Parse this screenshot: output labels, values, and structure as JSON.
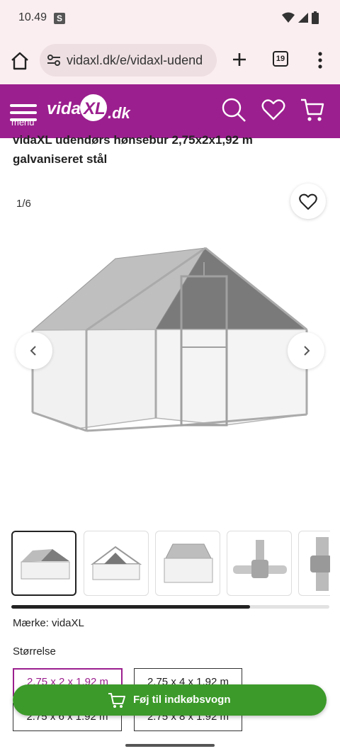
{
  "status_bar": {
    "time": "10.49",
    "badge": "S"
  },
  "browser": {
    "url": "vidaxl.dk/e/vidaxl-udend",
    "tab_count": "19"
  },
  "header": {
    "menu_label": "menu",
    "logo_text": "vidaXL.dk",
    "brand_color": "#9b1f8e"
  },
  "product": {
    "title_line1": "vidaXL udendørs hønsebur 2,75x2x1,92 m",
    "title_line2": "galvaniseret stål",
    "image_counter": "1/6",
    "brand_text": "Mærke: vidaXL",
    "size_label": "Størrelse",
    "gallery_progress": 0.75,
    "sizes": [
      {
        "label": "2.75 x 2 x 1.92 m",
        "selected": true
      },
      {
        "label": "2.75 x 4 x 1.92 m",
        "selected": false
      },
      {
        "label": "2.75 x 6 x 1.92 m",
        "selected": false
      },
      {
        "label": "2.75 x 8 x 1.92 m",
        "selected": false
      }
    ]
  },
  "cart_button": {
    "label": "Føj til indkøbsvogn",
    "color": "#3c9a2a"
  }
}
